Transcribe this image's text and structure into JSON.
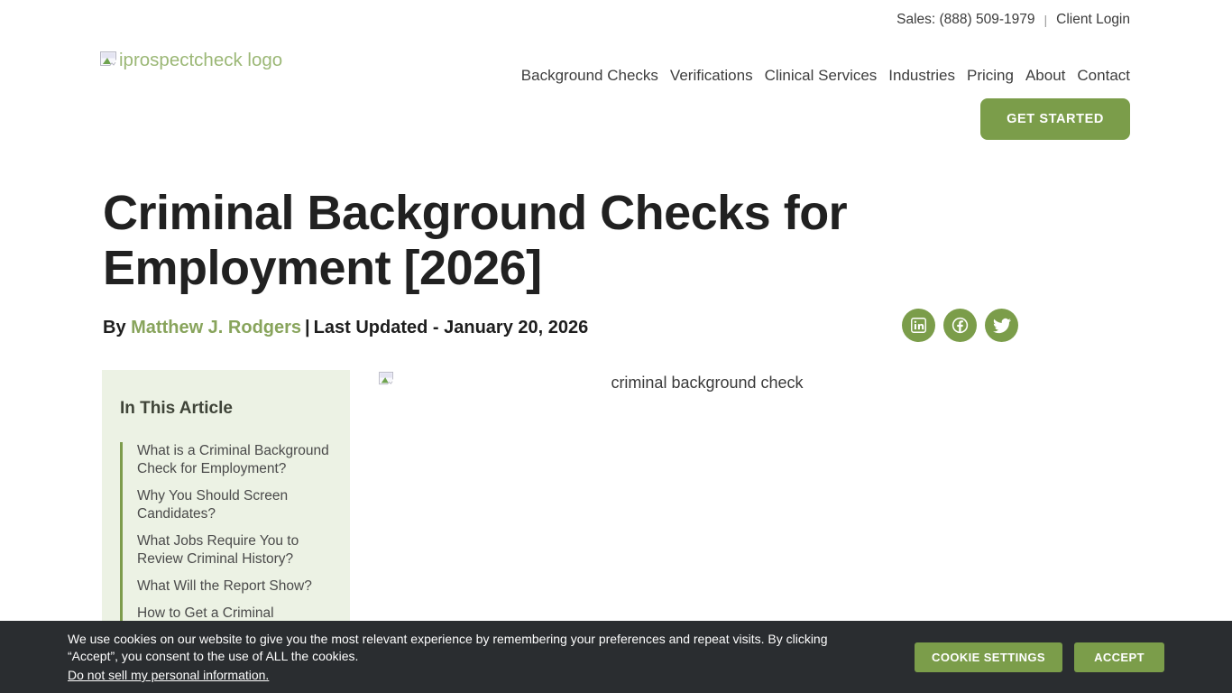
{
  "topbar": {
    "sales_label": "Sales: (888) 509-1979",
    "separator": "|",
    "client_login_label": "Client Login"
  },
  "header": {
    "logo_alt": "iprospectcheck logo",
    "nav": [
      "Background Checks",
      "Verifications",
      "Clinical Services",
      "Industries",
      "Pricing",
      "About",
      "Contact"
    ],
    "cta_label": "GET STARTED"
  },
  "article": {
    "title": "Criminal Background Checks for Employment [2026]",
    "byline_prefix": "By ",
    "author": "Matthew J. Rodgers",
    "byline_separator": "|",
    "last_updated": "Last Updated - January 20, 2026",
    "image_alt": "criminal background check",
    "social_icons": [
      "linkedin-icon",
      "facebook-icon",
      "twitter-icon"
    ]
  },
  "toc": {
    "heading": "In This Article",
    "items": [
      "What is a Criminal Background Check for Employment?",
      "Why You Should Screen Candidates?",
      "What Jobs Require You to Review Criminal History?",
      "What Will the Report Show?",
      "How to Get a Criminal"
    ]
  },
  "cookie_banner": {
    "message": "We use cookies on our website to give you the most relevant experience by remembering your preferences and repeat visits. By clicking “Accept”, you consent to the use of ALL the cookies.",
    "link_label": "Do not sell my personal information.",
    "settings_label": "COOKIE SETTINGS",
    "accept_label": "ACCEPT"
  },
  "colors": {
    "accent_green": "#7b9d4a",
    "logo_green": "#9cb877",
    "author_link_green": "#88a45c",
    "toc_background": "#ecf2e4",
    "toc_border_green": "#7d9c4c",
    "banner_background": "#2a2d30",
    "heading_text": "#212121"
  }
}
